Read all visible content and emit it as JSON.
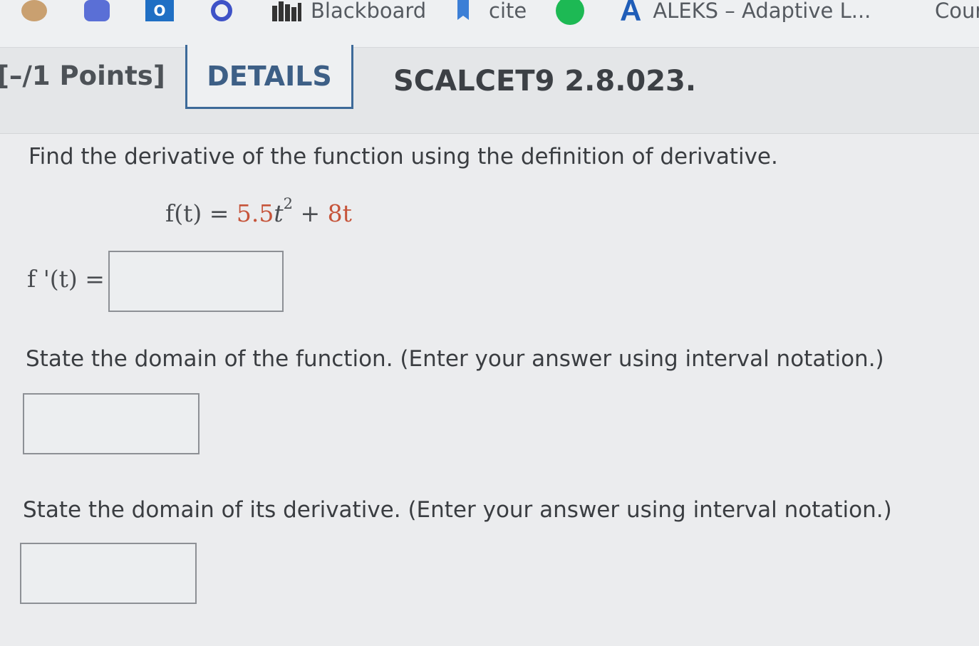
{
  "bookmarks": [
    {
      "icon": "bookmark-icon-1",
      "label": ""
    },
    {
      "icon": "bookmark-icon-2",
      "label": ""
    },
    {
      "icon": "outlook-icon",
      "label": ""
    },
    {
      "icon": "search-app-icon",
      "label": ""
    },
    {
      "icon": "blackboard-icon",
      "label": "Blackboard"
    },
    {
      "icon": "bookmark-flag-icon",
      "label": "cite"
    },
    {
      "icon": "spotify-icon",
      "label": ""
    },
    {
      "icon": "aleks-icon",
      "label": "ALEKS – Adaptive L..."
    },
    {
      "icon": "",
      "label": "Cour"
    }
  ],
  "question": {
    "points": "[–/1 Points]",
    "details_label": "DETAILS",
    "id": "SCALCET9 2.8.023."
  },
  "content": {
    "instruction": "Find the derivative of the function using the definition of derivative.",
    "function_lhs": "f(t) =",
    "coef": "5.5",
    "var": "t",
    "exponent": "2",
    "plus": "+",
    "linear_term": "8t",
    "derivative_lhs": "f '(t) =",
    "domain_function_prompt": "State the domain of the function. (Enter your answer using interval notation.)",
    "domain_derivative_prompt": "State the domain of its derivative. (Enter your answer using interval notation.)"
  },
  "colors": {
    "accent": "#3d6a99",
    "coefficient": "#c6543a"
  }
}
